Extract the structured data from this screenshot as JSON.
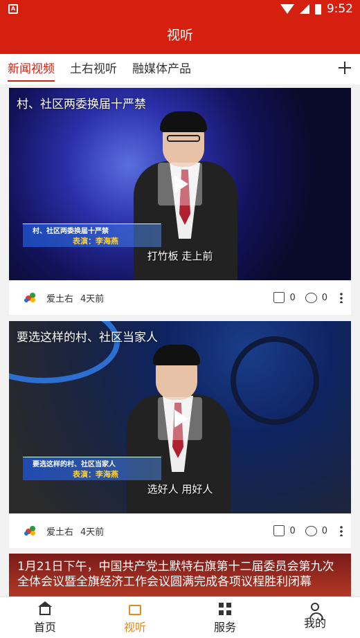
{
  "statusbar": {
    "time": "9:52"
  },
  "appbar": {
    "title": "视听"
  },
  "tabs": [
    {
      "label": "新闻视频",
      "active": true
    },
    {
      "label": "土右视听",
      "active": false
    },
    {
      "label": "融媒体产品",
      "active": false
    }
  ],
  "cards": [
    {
      "title": "村、社区两委换届十严禁",
      "banner_title": "村、社区两委换届十严禁",
      "banner_performer": "表演：李海燕",
      "subtitle": "打竹板  走上前",
      "author": "爱土右",
      "time": "4天前",
      "likes": "0",
      "comments": "0"
    },
    {
      "title": "要选这样的村、社区当家人",
      "banner_title": "要选这样的村、社区当家人",
      "banner_performer": "表演：李海燕",
      "subtitle": "选好人  用好人",
      "author": "爱土右",
      "time": "4天前",
      "likes": "0",
      "comments": "0"
    }
  ],
  "card3": {
    "title": "1月21日下午，中国共产党土默特右旗第十二届委员会第九次全体会议暨全旗经济工作会议圆满完成各项议程胜利闭幕"
  },
  "bottom_nav": [
    {
      "label": "首页",
      "icon": "home-icon",
      "active": false
    },
    {
      "label": "视听",
      "icon": "tv-icon",
      "active": true
    },
    {
      "label": "服务",
      "icon": "grid-icon",
      "active": false
    },
    {
      "label": "我的",
      "icon": "user-icon",
      "active": false
    }
  ],
  "colors": {
    "primary": "#d5200f",
    "nav_active": "#e08a1e"
  }
}
